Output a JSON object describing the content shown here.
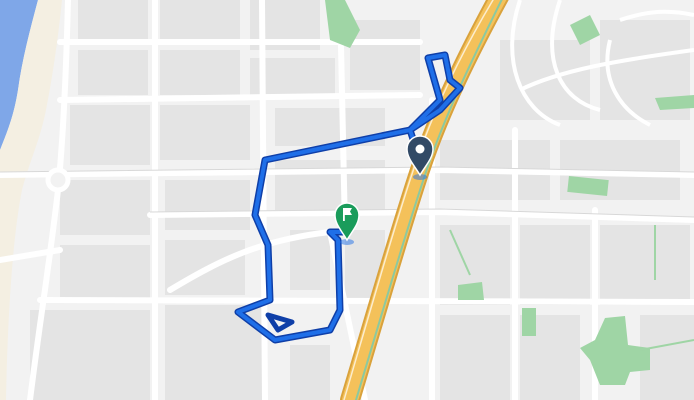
{
  "map": {
    "colors": {
      "background": "#f2f2f2",
      "water": "#7fa7e8",
      "beach": "#f4efe2",
      "block": "#e4e4e4",
      "street": "#ffffff",
      "street_outline": "#d8d8d8",
      "park": "#9fd5a5",
      "highway": "#f4c15a",
      "highway_edge": "#d9a23c",
      "rail": "#8bc9a0",
      "route": "#1f6fe8",
      "route_outline": "#0f3fa8",
      "start_marker": "#324a66",
      "end_marker": "#1a9c5b"
    },
    "markers": {
      "start": {
        "icon": "map-pin-icon"
      },
      "end": {
        "icon": "flag-pin-icon"
      }
    }
  }
}
